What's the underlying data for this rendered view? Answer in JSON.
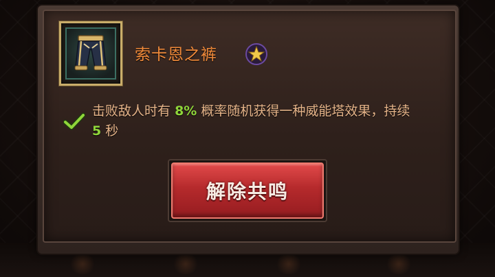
{
  "item": {
    "name": "索卡恩之裤",
    "icon": "pants-icon",
    "rarity_icon": "star-icon"
  },
  "effect": {
    "status_icon": "check-icon",
    "text_before": "击败敌人时有",
    "chance": "8%",
    "text_middle": "概率随机获得一种威能塔效果，持续",
    "duration": "5",
    "text_after": "秒"
  },
  "actions": {
    "unbind_label": "解除共鸣"
  },
  "colors": {
    "item_name": "#f08a3a",
    "effect_text": "#e6b489",
    "highlight": "#8fd53a",
    "button": "#b52a2c",
    "slot_border": "#c9ad6a"
  }
}
